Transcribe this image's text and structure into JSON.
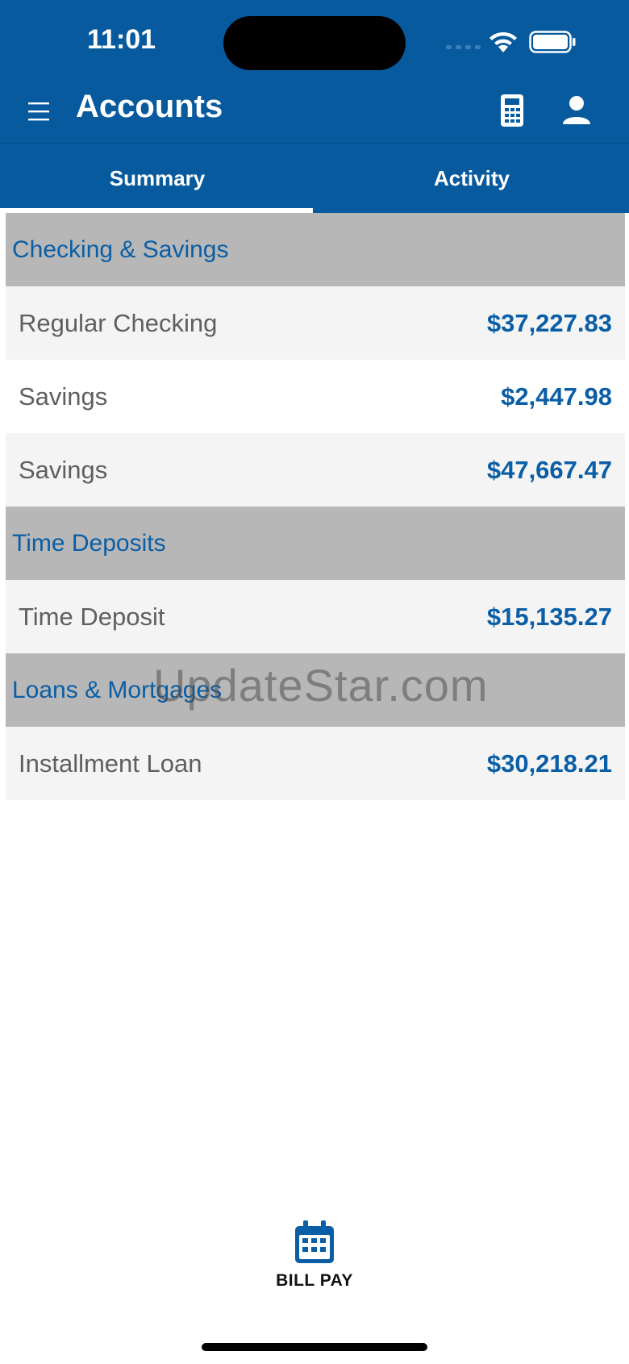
{
  "status_bar": {
    "time": "11:01"
  },
  "header": {
    "title": "Accounts"
  },
  "tabs": [
    {
      "label": "Summary",
      "selected": true
    },
    {
      "label": "Activity",
      "selected": false
    }
  ],
  "sections": [
    {
      "title": "Checking & Savings",
      "accounts": [
        {
          "name": "Regular Checking",
          "balance": "$37,227.83"
        },
        {
          "name": "Savings",
          "balance": "$2,447.98"
        },
        {
          "name": "Savings",
          "balance": "$47,667.47"
        }
      ]
    },
    {
      "title": "Time Deposits",
      "accounts": [
        {
          "name": "Time Deposit",
          "balance": "$15,135.27"
        }
      ]
    },
    {
      "title": "Loans & Mortgages",
      "accounts": [
        {
          "name": "Installment Loan",
          "balance": "$30,218.21"
        }
      ]
    }
  ],
  "watermark": "UpdateStar.com",
  "bottom_action": {
    "label": "BILL PAY",
    "icon": "calendar-icon"
  },
  "colors": {
    "brand_blue": "#075a9e",
    "link_blue": "#0a5ea6",
    "section_gray": "#b7b7b7",
    "row_shade": "#f4f4f4"
  },
  "icons": {
    "menu": "hamburger-menu-icon",
    "calculator": "calculator-icon",
    "profile": "user-profile-icon"
  }
}
